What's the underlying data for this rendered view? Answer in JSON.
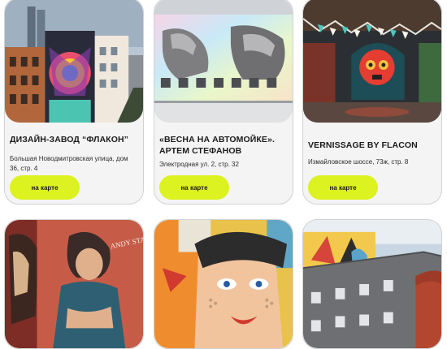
{
  "cards": [
    {
      "title": "Дизайн-завод “Флакон”",
      "address": "Большая Новодмитровская улица, дом 36, стр. 4",
      "button": "на карте"
    },
    {
      "title": "«Весна на автомойке». Артем Стефанов",
      "address": "Электродная ул. 2, стр. 32",
      "button": "на карте"
    },
    {
      "title": "Vernissage by Flacon",
      "address": "Измайловское шоссе, 73ж, стр. 8",
      "button": "на карте"
    }
  ],
  "mural_texts": {
    "card4": "ANDY STAEFANOV"
  },
  "colors": {
    "accent": "#dcf221",
    "card_bg": "#f4f4f4",
    "border": "#d2d2d2"
  }
}
